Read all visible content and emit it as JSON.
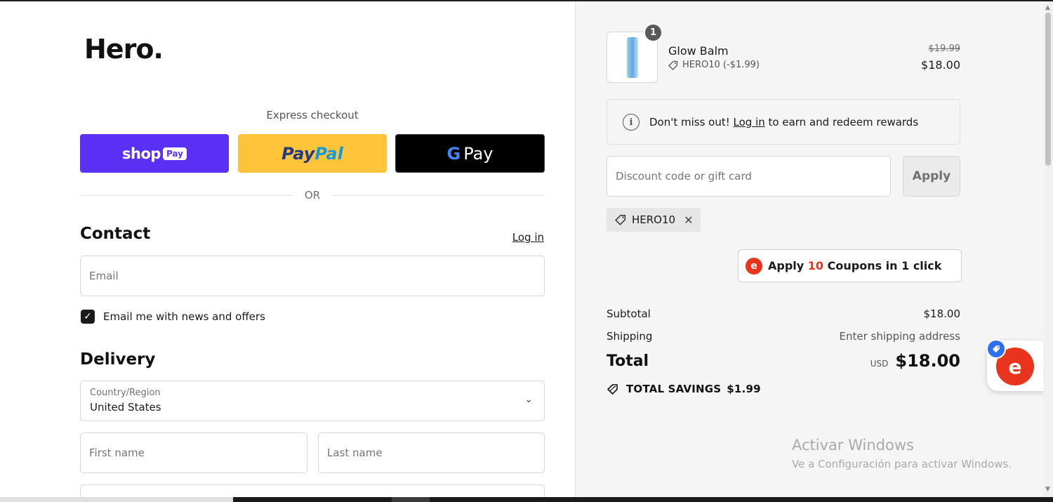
{
  "brand": {
    "logo": "Hero."
  },
  "express": {
    "label": "Express checkout",
    "shop_pay": {
      "word": "shop",
      "pill": "Pay"
    },
    "paypal": {
      "part1": "Pay",
      "part2": "Pal"
    },
    "gpay": {
      "g": "G",
      "text": "Pay"
    }
  },
  "divider": {
    "text": "OR"
  },
  "contact": {
    "title": "Contact",
    "login_link": "Log in",
    "email_placeholder": "Email",
    "newsletter_checked": true,
    "newsletter_label": "Email me with news and offers"
  },
  "delivery": {
    "title": "Delivery",
    "country_label": "Country/Region",
    "country_value": "United States",
    "first_name_placeholder": "First name",
    "last_name_placeholder": "Last name"
  },
  "cart": {
    "item": {
      "quantity": "1",
      "name": "Glow Balm",
      "discount": "HERO10 (-$1.99)",
      "original_price": "$19.99",
      "price": "$18.00"
    }
  },
  "rewards": {
    "prefix": "Don't miss out! ",
    "link": "Log in",
    "suffix": " to earn and redeem rewards"
  },
  "discount": {
    "placeholder": "Discount code or gift card",
    "apply_label": "Apply",
    "applied_code": "HERO10"
  },
  "coupon_ext": {
    "text_before": "Apply ",
    "count": "10",
    "text_after": " Coupons in 1 click"
  },
  "summary": {
    "subtotal_label": "Subtotal",
    "subtotal_value": "$18.00",
    "shipping_label": "Shipping",
    "shipping_value": "Enter shipping address",
    "total_label": "Total",
    "currency": "USD",
    "total_value": "$18.00",
    "savings_label": "TOTAL SAVINGS",
    "savings_value": "$1.99"
  },
  "watermark": {
    "title": "Activar Windows",
    "subtitle": "Ve a Configuración para activar Windows."
  },
  "colors": {
    "shop_pay": "#5a31f4",
    "paypal": "#ffc439",
    "gpay": "#000000",
    "coupon_accent": "#e8341c",
    "extension_badge": "#2d6ff0"
  },
  "icons": {
    "scroll_up": "▲",
    "scroll_down": "▼",
    "chevron": "⌄",
    "check": "✓",
    "info": "i",
    "remove": "✕",
    "coupon_logo": "e",
    "widget_logo": "e"
  }
}
